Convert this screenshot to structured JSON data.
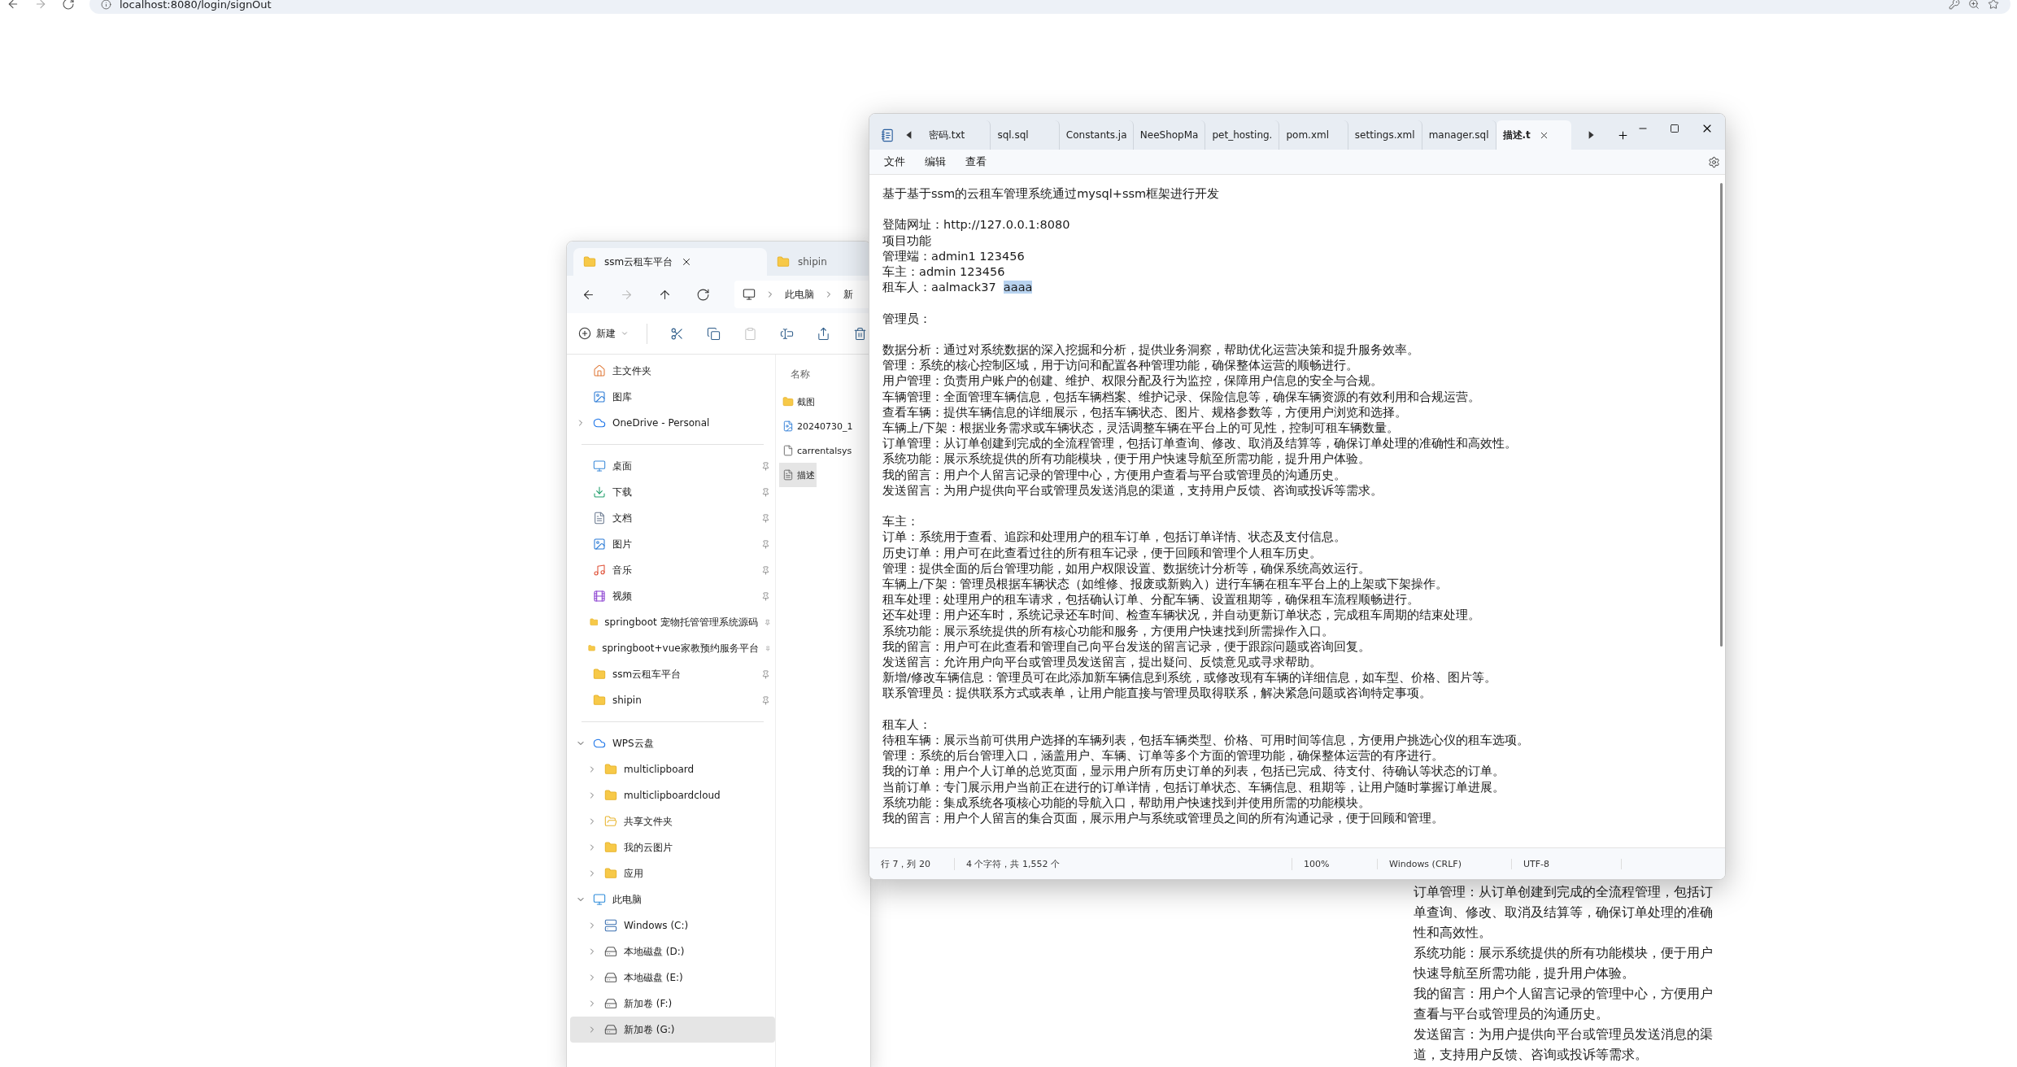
{
  "browser": {
    "url": "localhost:8080/login/signOut"
  },
  "explorer": {
    "tabs": [
      {
        "label": "ssm云租车平台",
        "selected": true
      },
      {
        "label": "shipin",
        "selected": false
      }
    ],
    "nav": [
      {
        "kind": "back",
        "disabled": false
      },
      {
        "kind": "forward",
        "disabled": true
      },
      {
        "kind": "up",
        "disabled": false
      },
      {
        "kind": "refresh",
        "disabled": false
      }
    ],
    "breadcrumb": [
      "此电脑",
      "新"
    ],
    "new_button": {
      "label": "新建"
    },
    "toolbar": [
      {
        "kind": "cut",
        "disabled": false
      },
      {
        "kind": "copy",
        "disabled": false
      },
      {
        "kind": "paste",
        "disabled": true
      },
      {
        "kind": "rename",
        "disabled": false
      },
      {
        "kind": "share",
        "disabled": false
      },
      {
        "kind": "delete",
        "disabled": false
      }
    ],
    "sidebar": [
      [
        {
          "label": "主文件夹",
          "kind": "home",
          "selected": false,
          "pinned": false
        },
        {
          "label": "图库",
          "kind": "gallery",
          "selected": false,
          "pinned": false
        },
        {
          "label": "OneDrive - Personal",
          "kind": "cloud",
          "selected": false,
          "pinned": false,
          "expanded": false
        }
      ],
      [
        {
          "label": "桌面",
          "kind": "desktop",
          "selected": false,
          "pinned": true
        },
        {
          "label": "下载",
          "kind": "download",
          "selected": false,
          "pinned": true
        },
        {
          "label": "文档",
          "kind": "documents",
          "selected": false,
          "pinned": true
        },
        {
          "label": "图片",
          "kind": "pictures",
          "selected": false,
          "pinned": true
        },
        {
          "label": "音乐",
          "kind": "music",
          "selected": false,
          "pinned": true
        },
        {
          "label": "视频",
          "kind": "videos",
          "selected": false,
          "pinned": true
        },
        {
          "label": "springboot 宠物托管管理系统源码",
          "kind": "folder",
          "selected": false,
          "pinned": true
        },
        {
          "label": "springboot+vue家教预约服务平台",
          "kind": "folder",
          "selected": false,
          "pinned": true
        },
        {
          "label": "ssm云租车平台",
          "kind": "folder",
          "selected": false,
          "pinned": true
        },
        {
          "label": "shipin",
          "kind": "folder",
          "selected": false,
          "pinned": true
        }
      ],
      [
        {
          "label": "WPS云盘",
          "kind": "cloud",
          "selected": false,
          "pinned": false,
          "expanded": true,
          "children": [
            {
              "label": "multiclipboard",
              "kind": "folder",
              "selected": false,
              "pinned": false,
              "expanded": false
            },
            {
              "label": "multiclipboardcloud",
              "kind": "folder",
              "selected": false,
              "pinned": false,
              "expanded": false
            },
            {
              "label": "共享文件夹",
              "kind": "shared",
              "selected": false,
              "pinned": false,
              "expanded": false
            },
            {
              "label": "我的云图片",
              "kind": "folder",
              "selected": false,
              "pinned": false,
              "expanded": false
            },
            {
              "label": "应用",
              "kind": "folder",
              "selected": false,
              "pinned": false,
              "expanded": false
            }
          ]
        },
        {
          "label": "此电脑",
          "kind": "pc",
          "selected": false,
          "pinned": false,
          "expanded": true,
          "children": [
            {
              "label": "Windows (C:)",
              "kind": "system-drive",
              "selected": false,
              "pinned": false,
              "expanded": false
            },
            {
              "label": "本地磁盘 (D:)",
              "kind": "drive",
              "selected": false,
              "pinned": false,
              "expanded": false
            },
            {
              "label": "本地磁盘 (E:)",
              "kind": "drive",
              "selected": false,
              "pinned": false,
              "expanded": false
            },
            {
              "label": "新加卷 (F:)",
              "kind": "drive",
              "selected": false,
              "pinned": false,
              "expanded": false
            },
            {
              "label": "新加卷 (G:)",
              "kind": "drive",
              "selected": true,
              "pinned": false,
              "expanded": false
            }
          ]
        }
      ]
    ],
    "files": {
      "column": "名称",
      "items": [
        {
          "name": "截图",
          "kind": "folder",
          "selected": false
        },
        {
          "name": "20240730_1",
          "kind": "media",
          "selected": false
        },
        {
          "name": "carrentalsys",
          "kind": "file",
          "selected": false
        },
        {
          "name": "描述",
          "kind": "text",
          "selected": true
        }
      ]
    }
  },
  "notepad": {
    "tabs": [
      {
        "label": "密码.txt",
        "selected": false
      },
      {
        "label": "sql.sql",
        "selected": false
      },
      {
        "label": "Constants.ja",
        "selected": false
      },
      {
        "label": "NeeShopMa",
        "selected": false
      },
      {
        "label": "pet_hosting.",
        "selected": false
      },
      {
        "label": "pom.xml",
        "selected": false
      },
      {
        "label": "settings.xml",
        "selected": false
      },
      {
        "label": "manager.sql",
        "selected": false
      },
      {
        "label": "描述.t",
        "selected": true
      }
    ],
    "menu": [
      "文件",
      "编辑",
      "查看"
    ],
    "paragraphs": [
      [
        {
          "text": "基于基于ssm的云租车管理系统通过mysql+ssm框架进行开发"
        }
      ],
      [
        {
          "text": "登陆网址：http://127.0.0.1:8080"
        },
        {
          "text": "项目功能"
        },
        {
          "text": "管理端：admin1 123456"
        },
        {
          "text": "车主：admin 123456"
        },
        {
          "text": "租车人：aalmack37  ",
          "selection": "aaaa"
        }
      ],
      [
        {
          "text": "管理员："
        }
      ],
      [
        {
          "text": "数据分析：通过对系统数据的深入挖掘和分析，提供业务洞察，帮助优化运营决策和提升服务效率。"
        },
        {
          "text": "管理：系统的核心控制区域，用于访问和配置各种管理功能，确保整体运营的顺畅进行。"
        },
        {
          "text": "用户管理：负责用户账户的创建、维护、权限分配及行为监控，保障用户信息的安全与合规。"
        },
        {
          "text": "车辆管理：全面管理车辆信息，包括车辆档案、维护记录、保险信息等，确保车辆资源的有效利用和合规运营。"
        },
        {
          "text": "查看车辆：提供车辆信息的详细展示，包括车辆状态、图片、规格参数等，方便用户浏览和选择。"
        },
        {
          "text": "车辆上/下架：根据业务需求或车辆状态，灵活调整车辆在平台上的可见性，控制可租车辆数量。"
        },
        {
          "text": "订单管理：从订单创建到完成的全流程管理，包括订单查询、修改、取消及结算等，确保订单处理的准确性和高效性。"
        },
        {
          "text": "系统功能：展示系统提供的所有功能模块，便于用户快速导航至所需功能，提升用户体验。"
        },
        {
          "text": "我的留言：用户个人留言记录的管理中心，方便用户查看与平台或管理员的沟通历史。"
        },
        {
          "text": "发送留言：为用户提供向平台或管理员发送消息的渠道，支持用户反馈、咨询或投诉等需求。"
        }
      ],
      [
        {
          "text": "车主："
        },
        {
          "text": "订单：系统用于查看、追踪和处理用户的租车订单，包括订单详情、状态及支付信息。"
        },
        {
          "text": "历史订单：用户可在此查看过往的所有租车记录，便于回顾和管理个人租车历史。"
        },
        {
          "text": "管理：提供全面的后台管理功能，如用户权限设置、数据统计分析等，确保系统高效运行。"
        },
        {
          "text": "车辆上/下架：管理员根据车辆状态（如维修、报废或新购入）进行车辆在租车平台上的上架或下架操作。"
        },
        {
          "text": "租车处理：处理用户的租车请求，包括确认订单、分配车辆、设置租期等，确保租车流程顺畅进行。"
        },
        {
          "text": "还车处理：用户还车时，系统记录还车时间、检查车辆状况，并自动更新订单状态，完成租车周期的结束处理。"
        },
        {
          "text": "系统功能：展示系统提供的所有核心功能和服务，方便用户快速找到所需操作入口。"
        },
        {
          "text": "我的留言：用户可在此查看和管理自己向平台发送的留言记录，便于跟踪问题或咨询回复。"
        },
        {
          "text": "发送留言：允许用户向平台或管理员发送留言，提出疑问、反馈意见或寻求帮助。"
        },
        {
          "text": "新增/修改车辆信息：管理员可在此添加新车辆信息到系统，或修改现有车辆的详细信息，如车型、价格、图片等。"
        },
        {
          "text": "联系管理员：提供联系方式或表单，让用户能直接与管理员取得联系，解决紧急问题或咨询特定事项。"
        }
      ],
      [
        {
          "text": "租车人："
        },
        {
          "text": "待租车辆：展示当前可供用户选择的车辆列表，包括车辆类型、价格、可用时间等信息，方便用户挑选心仪的租车选项。"
        },
        {
          "text": "管理：系统的后台管理入口，涵盖用户、车辆、订单等多个方面的管理功能，确保整体运营的有序进行。"
        },
        {
          "text": "我的订单：用户个人订单的总览页面，显示用户所有历史订单的列表，包括已完成、待支付、待确认等状态的订单。"
        },
        {
          "text": "当前订单：专门展示用户当前正在进行的订单详情，包括订单状态、车辆信息、租期等，让用户随时掌握订单进展。"
        },
        {
          "text": "系统功能：集成系统各项核心功能的导航入口，帮助用户快速找到并使用所需的功能模块。"
        },
        {
          "text": "我的留言：用户个人留言的集合页面，展示用户与系统或管理员之间的所有沟通记录，便于回顾和管理。"
        }
      ]
    ],
    "status": [
      "行 7，列 20",
      "4 个字符，共 1,552 个",
      "100%",
      "Windows (CRLF)",
      "UTF-8"
    ]
  },
  "webpage": {
    "paragraphs": [
      "订单管理：从订单创建到完成的全流程管理，包括订单查询、修改、取消及结算等，确保订单处理的准确性和高效性。",
      "系统功能：展示系统提供的所有功能模块，便于用户快速导航至所需功能，提升用户体验。",
      "我的留言：用户个人留言记录的管理中心，方便用户查看与平台或管理员的沟通历史。",
      "发送留言：为用户提供向平台或管理员发送消息的渠道，支持用户反馈、咨询或投诉等需求。"
    ]
  }
}
